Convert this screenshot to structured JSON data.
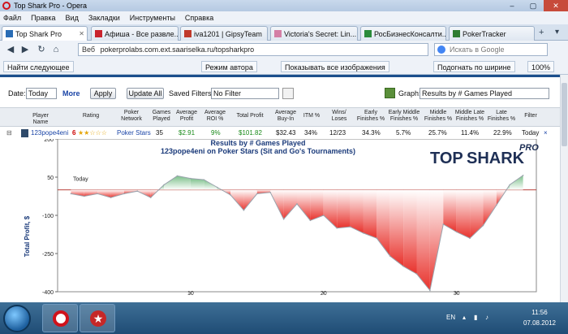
{
  "window": {
    "title": "Top Shark Pro - Opera",
    "controls": [
      "–",
      "▢",
      "✕"
    ]
  },
  "menu": [
    "Файл",
    "Правка",
    "Вид",
    "Закладки",
    "Инструменты",
    "Справка"
  ],
  "tabs": [
    {
      "label": "Top Shark Pro",
      "active": true,
      "icon_color": "#2a6db5"
    },
    {
      "label": "Афиша - Все развле...",
      "active": false,
      "icon_color": "#c9232d"
    },
    {
      "label": "iva1201 | GipsyTeam",
      "active": false,
      "icon_color": "#c0392b"
    },
    {
      "label": "Victoria's Secret: Lin...",
      "active": false,
      "icon_color": "#d47fa6"
    },
    {
      "label": "РосБизнесКонсалти...",
      "active": false,
      "icon_color": "#2a8b3b"
    },
    {
      "label": "PokerTracker",
      "active": false,
      "icon_color": "#2f7d32"
    }
  ],
  "address": {
    "prefix": "Веб",
    "url": "pokerprolabs.com.ext.saariselka.ru/topsharkpro",
    "search_placeholder": "Искать в Google"
  },
  "toolbar": {
    "find_next": "Найти следующее",
    "author_mode": "Режим автора",
    "show_images": "Показывать все изображения",
    "fit_width": "Подогнать по ширине",
    "zoom": "100%"
  },
  "filters": {
    "date_label": "Date:",
    "date_value": "Today",
    "more": "More",
    "apply": "Apply",
    "update_all": "Update All",
    "saved_filters_label": "Saved Filters:",
    "saved_filters_value": "No Filter",
    "graph_label": "Graph:",
    "graph_value": "Results by # Games Played"
  },
  "table": {
    "headers": [
      "Player Name",
      "Rating",
      "Poker Network",
      "Games Played",
      "Average Profit",
      "Average ROI %",
      "Total Profit",
      "Average Buy-In",
      "ITM %",
      "Wins/ Loses",
      "Early Finishes %",
      "Early Middle Finishes %",
      "Middle Finishes %",
      "Middle Late Finishes %",
      "Late Finishes %",
      "Filter"
    ],
    "row": {
      "expander": "⊟",
      "player": "123pope4eni",
      "rating_num": "6",
      "stars": "★★☆☆☆",
      "network": "Poker Stars",
      "games": "35",
      "avg_profit": "$2.91",
      "avg_roi": "9%",
      "total_profit": "$101.82",
      "avg_buyin": "$32.43",
      "itm": "34%",
      "wins_loses": "12/23",
      "early": "34.3%",
      "early_middle": "5.7%",
      "middle": "25.7%",
      "middle_late": "11.4%",
      "late": "22.9%",
      "filter": "Today",
      "remove": "×"
    }
  },
  "logo": {
    "text_top": "TOP",
    "text_bottom": "SHARK",
    "badge": "PRO"
  },
  "chart_data": {
    "type": "area",
    "title": "Results by # Games Played",
    "subtitle": "123pope4eni on Poker Stars (Sit and Go's Tournaments)",
    "ylabel": "Total Profit, $",
    "xlabel": "",
    "ylim": [
      -400,
      200
    ],
    "xlim": [
      0,
      36
    ],
    "yticks": [
      200,
      50,
      -100,
      -250,
      -400
    ],
    "xticks": [
      10,
      20,
      30
    ],
    "reference_line": {
      "label": "Today",
      "y": 0
    },
    "x": [
      1,
      2,
      3,
      4,
      5,
      6,
      7,
      8,
      9,
      10,
      11,
      12,
      13,
      14,
      15,
      16,
      17,
      18,
      19,
      20,
      21,
      22,
      23,
      24,
      25,
      26,
      27,
      28,
      29,
      30,
      31,
      32,
      33,
      34,
      35
    ],
    "values": [
      -15,
      -25,
      -15,
      -30,
      -15,
      -5,
      -30,
      20,
      55,
      45,
      40,
      10,
      -20,
      -80,
      -15,
      -10,
      -115,
      -55,
      -120,
      -100,
      -150,
      -145,
      -170,
      -190,
      -260,
      -300,
      -330,
      -395,
      -135,
      -165,
      -190,
      -140,
      -60,
      20,
      57
    ],
    "colors": {
      "positive": "#8ec89a",
      "negative": "#e8322c",
      "reference": "#b9433d",
      "line": "#9aa3ad"
    }
  },
  "taskbar": {
    "lang": "EN",
    "time": "11:56",
    "date": "07.08.2012"
  }
}
